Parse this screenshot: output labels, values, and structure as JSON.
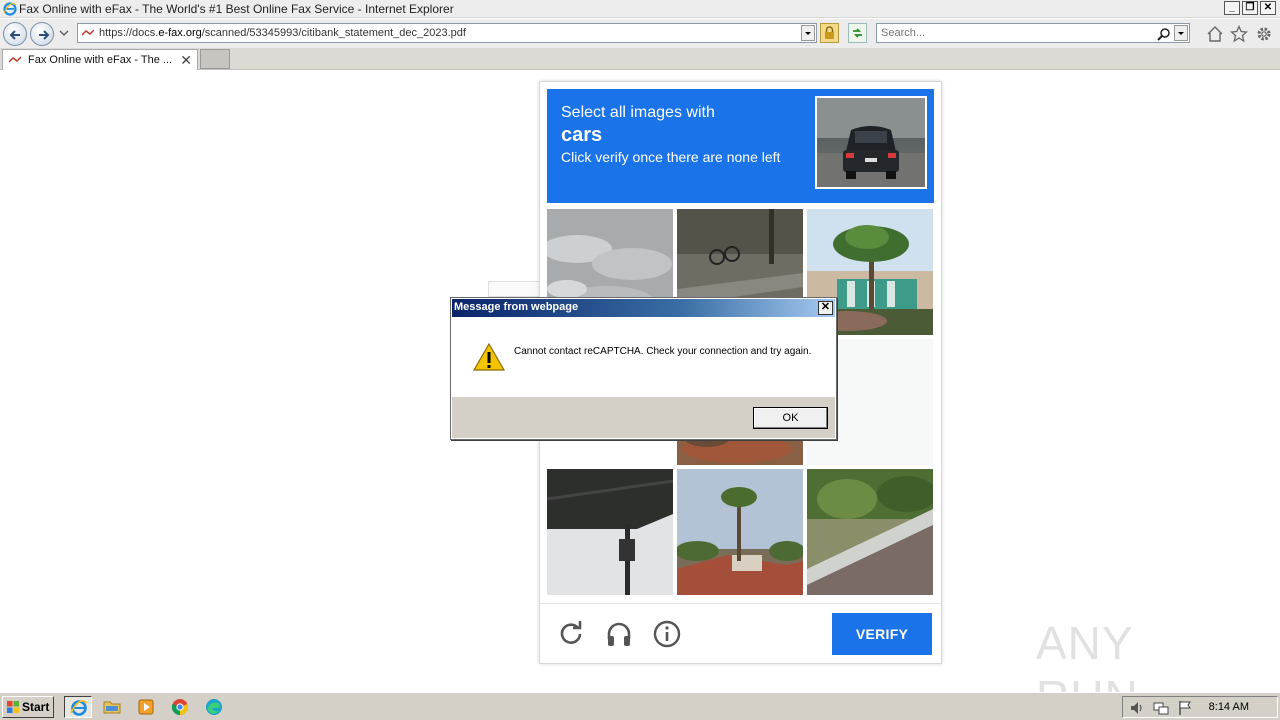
{
  "window": {
    "title": "Fax Online with eFax - The World's #1 Best Online Fax Service - Internet Explorer",
    "buttons": {
      "minimize": "_",
      "restore": "❐",
      "close": "✕"
    }
  },
  "address_bar": {
    "url_prefix": "https://docs.",
    "url_domain": "e-fax.org",
    "url_path": "/scanned/53345993/citibank_statement_dec_2023.pdf"
  },
  "search": {
    "placeholder": "Search..."
  },
  "tab": {
    "label": "Fax Online with eFax - The ...",
    "close": "✕"
  },
  "captcha": {
    "header_line1": "Select all images with",
    "header_keyword": "cars",
    "header_line3": "Click verify once there are none left",
    "verify_label": "VERIFY",
    "tiles": [
      {
        "name": "tile-clouds",
        "desc": "sky-clouds"
      },
      {
        "name": "tile-street-bike",
        "desc": "street"
      },
      {
        "name": "tile-palm-tree",
        "desc": "palm"
      },
      {
        "name": "tile-blank-1",
        "desc": "blank"
      },
      {
        "name": "tile-autumn-tree",
        "desc": "tree"
      },
      {
        "name": "tile-blank-2",
        "desc": "blank"
      },
      {
        "name": "tile-signal-pole",
        "desc": "pole"
      },
      {
        "name": "tile-palm-roofs",
        "desc": "roofs"
      },
      {
        "name": "tile-road-hedge",
        "desc": "road"
      }
    ],
    "accent_color": "#1a73e8"
  },
  "message_box": {
    "title": "Message from webpage",
    "text": "Cannot contact reCAPTCHA. Check your connection and try again.",
    "ok_label": "OK",
    "close_glyph": "✕"
  },
  "watermark": {
    "text": "ANY RUN"
  },
  "taskbar": {
    "start_label": "Start",
    "clock": "8:14 AM"
  }
}
